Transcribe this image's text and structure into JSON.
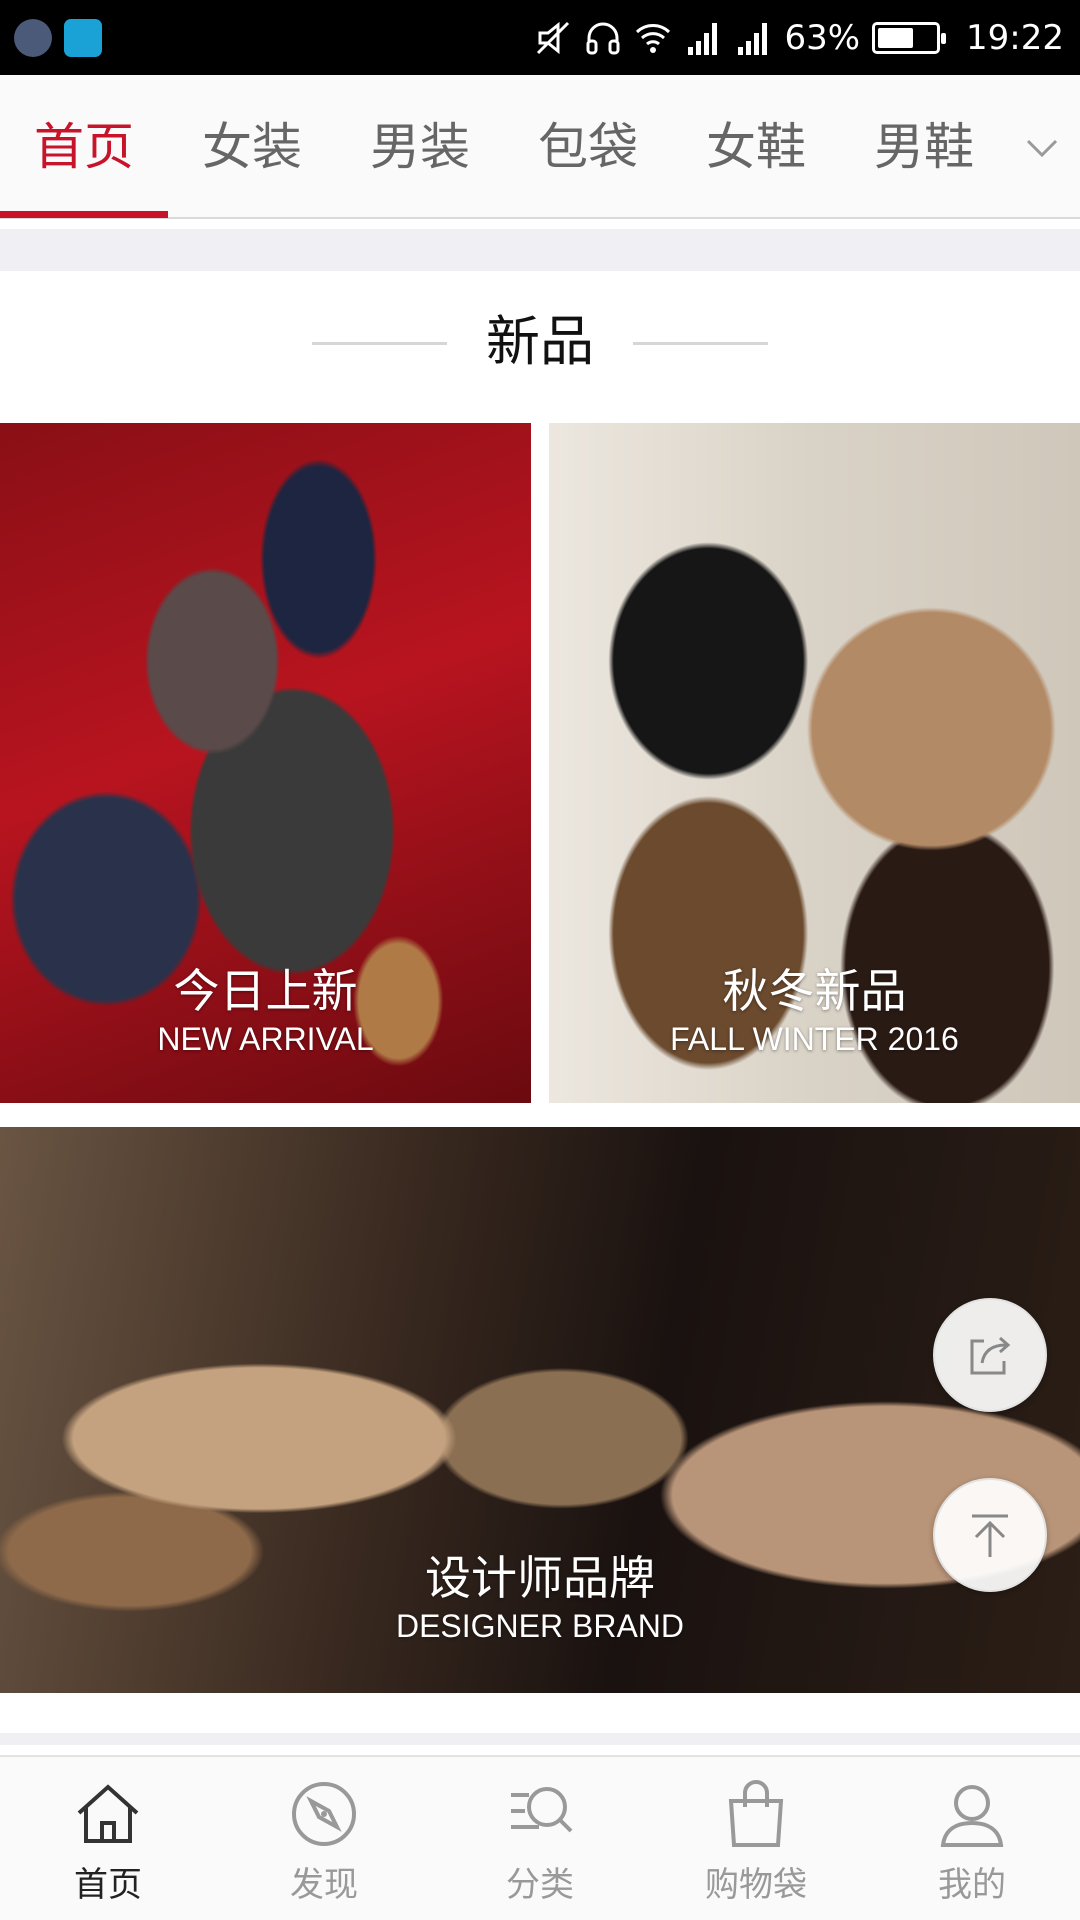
{
  "status_bar": {
    "battery": "63%",
    "battery_level": 0.63,
    "time": "19:22",
    "icons": [
      "notification-app-icon",
      "notification-shield-icon",
      "mute-icon",
      "headset-icon",
      "wifi-icon",
      "signal-icon",
      "signal-icon-2",
      "battery-icon"
    ]
  },
  "tabs": [
    {
      "label": "首页",
      "active": true
    },
    {
      "label": "女装",
      "active": false
    },
    {
      "label": "男装",
      "active": false
    },
    {
      "label": "包袋",
      "active": false
    },
    {
      "label": "女鞋",
      "active": false
    },
    {
      "label": "男鞋",
      "active": false
    }
  ],
  "tab_more_icon": "chevron-down-icon",
  "section": {
    "title": "新品"
  },
  "tiles": {
    "new_arrival": {
      "cn": "今日上新",
      "en": "NEW ARRIVAL"
    },
    "fall_winter": {
      "cn": "秋冬新品",
      "en": "FALL WINTER 2016"
    },
    "designer": {
      "cn": "设计师品牌",
      "en": "DESIGNER BRAND"
    }
  },
  "floating_buttons": [
    "share-icon",
    "back-to-top-icon"
  ],
  "bottom_nav": [
    {
      "label": "首页",
      "icon": "home-icon",
      "active": true
    },
    {
      "label": "发现",
      "icon": "compass-icon",
      "active": false
    },
    {
      "label": "分类",
      "icon": "category-search-icon",
      "active": false
    },
    {
      "label": "购物袋",
      "icon": "shopping-bag-icon",
      "active": false
    },
    {
      "label": "我的",
      "icon": "profile-icon",
      "active": false
    }
  ],
  "colors": {
    "accent": "#c8142b",
    "inactive_text": "#666666",
    "nav_inactive": "#999999"
  }
}
